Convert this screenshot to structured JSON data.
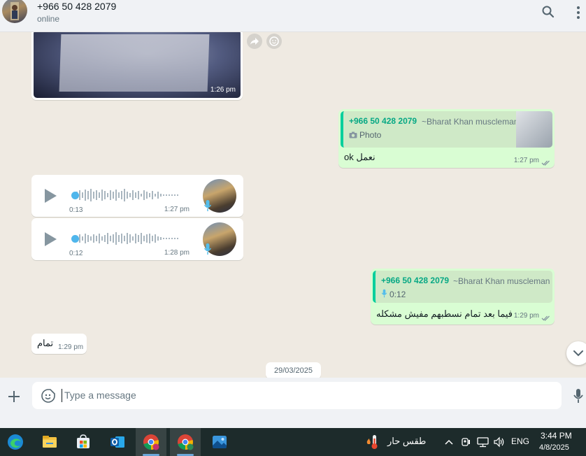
{
  "header": {
    "contact_name": "+966 50 428 2079",
    "status": "online",
    "search_icon": "search-icon",
    "more_icon": "more-options-icon"
  },
  "messages": {
    "image_message": {
      "time": "1:26 pm"
    },
    "reply_photo": {
      "quote_phone": "+966 50 428 2079",
      "quote_name": "~Bharat Khan muscleman",
      "quote_label": "Photo",
      "text": "ok نعمل",
      "time": "1:27 pm"
    },
    "voice_1": {
      "duration": "0:13",
      "time": "1:27 pm"
    },
    "voice_2": {
      "duration": "0:12",
      "time": "1:28 pm"
    },
    "reply_voice": {
      "quote_phone": "+966 50 428 2079",
      "quote_name": "~Bharat Khan muscleman",
      "quote_duration": "0:12",
      "text": "فيما بعد تمام نسطبهم مفيش مشكله",
      "time": "1:29 pm"
    },
    "tamam": {
      "text": "تمام",
      "time": "1:29 pm"
    },
    "date_chip": "29/03/2025"
  },
  "composer": {
    "placeholder": "Type a message"
  },
  "taskbar": {
    "weather": "طقس حار",
    "language": "ENG",
    "time": "3:44 PM",
    "date": "4/8/2025",
    "apps": [
      "edge-icon",
      "file-explorer-icon",
      "microsoft-store-icon",
      "outlook-icon",
      "chrome-icon",
      "chrome-profile-icon",
      "photos-icon"
    ]
  },
  "colors": {
    "accent_green": "#06cf9c",
    "outgoing_bubble": "#d9fdd3",
    "incoming_bubble": "#ffffff",
    "chat_bg": "#efeae2",
    "tick_blue": "#53bdeb"
  }
}
